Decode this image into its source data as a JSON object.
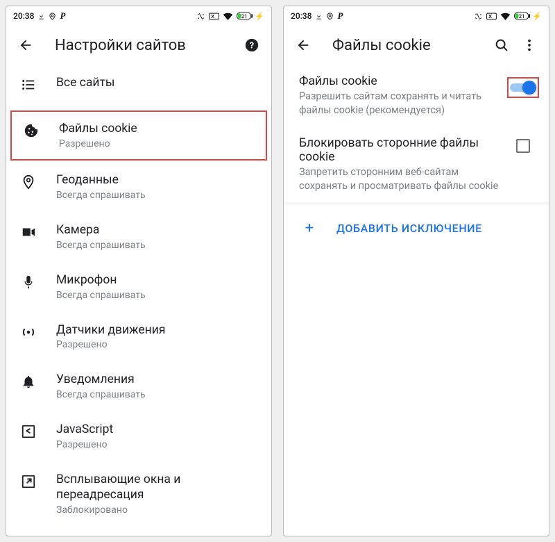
{
  "status": {
    "time": "20:38",
    "battery": "21"
  },
  "left": {
    "header": {
      "title": "Настройки сайтов"
    },
    "items": [
      {
        "icon": "list",
        "title": "Все сайты",
        "sub": ""
      },
      {
        "icon": "cookie",
        "title": "Файлы cookie",
        "sub": "Разрешено",
        "highlight": true
      },
      {
        "icon": "location",
        "title": "Геоданные",
        "sub": "Всегда спрашивать"
      },
      {
        "icon": "camera",
        "title": "Камера",
        "sub": "Всегда спрашивать"
      },
      {
        "icon": "mic",
        "title": "Микрофон",
        "sub": "Всегда спрашивать"
      },
      {
        "icon": "motion",
        "title": "Датчики движения",
        "sub": "Разрешено"
      },
      {
        "icon": "bell",
        "title": "Уведомления",
        "sub": "Всегда спрашивать"
      },
      {
        "icon": "js",
        "title": "JavaScript",
        "sub": "Разрешено"
      },
      {
        "icon": "popup",
        "title": "Всплывающие окна и переадресация",
        "sub": "Заблокировано"
      }
    ]
  },
  "right": {
    "header": {
      "title": "Файлы cookie"
    },
    "row1": {
      "title": "Файлы cookie",
      "sub": "Разрешить сайтам сохранять и читать файлы cookie (рекомендуется)",
      "toggle_on": true
    },
    "row2": {
      "title": "Блокировать сторонние файлы cookie",
      "sub": "Запретить сторонним веб-сайтам сохранять и просматривать файлы cookie",
      "checked": false
    },
    "add": {
      "label": "ДОБАВИТЬ ИСКЛЮЧЕНИЕ"
    }
  }
}
